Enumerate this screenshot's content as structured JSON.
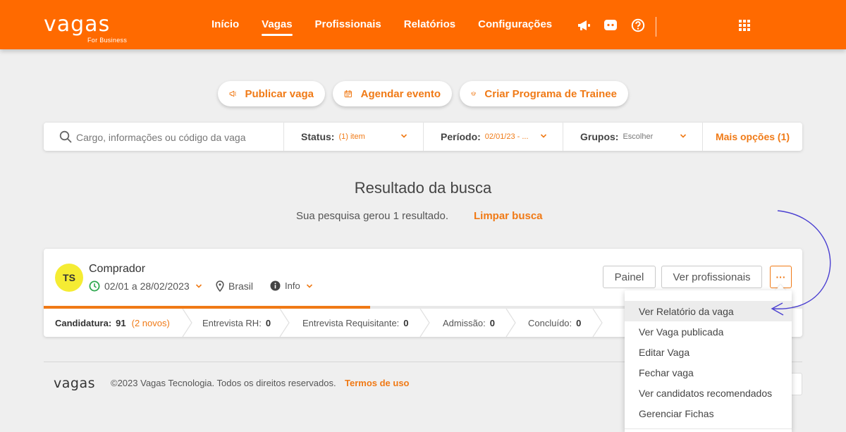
{
  "header": {
    "logo_text": "vagas",
    "logo_sub": "For Business",
    "nav": [
      {
        "label": "Início",
        "active": false
      },
      {
        "label": "Vagas",
        "active": true
      },
      {
        "label": "Profissionais",
        "active": false
      },
      {
        "label": "Relatórios",
        "active": false
      },
      {
        "label": "Configurações",
        "active": false
      }
    ],
    "icons": [
      "megaphone-icon",
      "chat-icon",
      "help-icon",
      "apps-grid-icon"
    ]
  },
  "actions": {
    "publish": "Publicar vaga",
    "schedule": "Agendar evento",
    "trainee": "Criar Programa de Trainee"
  },
  "filters": {
    "search_placeholder": "Cargo, informações ou código da vaga",
    "status_label": "Status:",
    "status_value": "(1) item",
    "period_label": "Período:",
    "period_value": "02/01/23 - ...",
    "groups_label": "Grupos:",
    "groups_value": "Escolher",
    "more_options": "Mais opções (1)"
  },
  "results": {
    "title": "Resultado da busca",
    "summary": "Sua pesquisa gerou 1 resultado.",
    "clear": "Limpar busca"
  },
  "vacancy": {
    "initials": "TS",
    "title": "Comprador",
    "period": "02/01 a 28/02/2023",
    "location": "Brasil",
    "info": "Info",
    "panel_button": "Painel",
    "professionals_button": "Ver profissionais",
    "more_button": "···",
    "progress_percent": 43,
    "stages": [
      {
        "label": "Candidatura:",
        "count": "91",
        "extra": "(2 novos)"
      },
      {
        "label": "Entrevista RH:",
        "count": "0"
      },
      {
        "label": "Entrevista Requisitante:",
        "count": "0"
      },
      {
        "label": "Admissão:",
        "count": "0"
      },
      {
        "label": "Concluído:",
        "count": "0"
      }
    ]
  },
  "menu": {
    "items": [
      {
        "label": "Ver Relatório da vaga",
        "highlighted": true
      },
      {
        "label": "Ver Vaga publicada",
        "highlighted": false
      },
      {
        "label": "Editar Vaga",
        "highlighted": false
      },
      {
        "label": "Fechar vaga",
        "highlighted": false
      },
      {
        "label": "Ver candidatos recomendados",
        "highlighted": false
      },
      {
        "label": "Gerenciar Fichas",
        "highlighted": false
      }
    ]
  },
  "footer": {
    "logo": "vagas",
    "copyright": "©2023 Vagas Tecnologia. Todos os direitos reservados.",
    "terms": "Termos de uso"
  },
  "colors": {
    "brand_orange": "#ff6a00",
    "accent_orange": "#f07a16",
    "annotation_arrow": "#4a3fd1",
    "avatar_yellow": "#f5ec33",
    "clock_green": "#2fa84f"
  }
}
